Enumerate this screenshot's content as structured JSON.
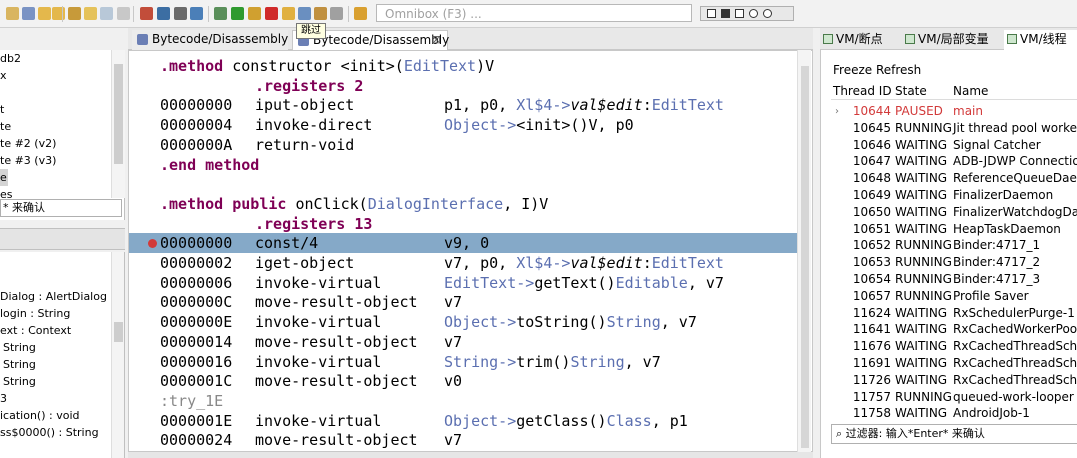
{
  "toolbar": {
    "omnibox_placeholder": "Omnibox (F3) ...",
    "tooltip": "跳过"
  },
  "left_panel": {
    "top_items": [
      "db2",
      "x",
      "",
      "t",
      "te",
      "te #2 (v2)",
      "te #3 (v3)",
      "e",
      "es"
    ],
    "filter_text": "* 来确认",
    "bottom_items": [
      "Dialog : AlertDialog",
      "login : String",
      "ext : Context",
      "String",
      "String",
      "String",
      "3",
      "ication() : void",
      "ss$0000() : String"
    ]
  },
  "editor": {
    "tabs": [
      {
        "label": "Bytecode/Disassembly"
      },
      {
        "label": "Bytecode/Disassembly",
        "close": "⊠"
      }
    ],
    "lines": [
      {
        "type": "directive",
        "kw": ".method",
        "text": " constructor <init>(",
        "ty": "EditText",
        "end": ")V"
      },
      {
        "type": "registers",
        "text": ".registers 2"
      },
      {
        "type": "instr",
        "addr": "00000000",
        "op": "iput-object",
        "args_pre": "p1, p0, ",
        "args_ty": "Xl$4->",
        "args_it": "val$edit",
        "args_post": ":",
        "args_ty2": "EditText"
      },
      {
        "type": "instr",
        "addr": "00000004",
        "op": "invoke-direct",
        "args_ty": "Object->",
        "args_pre": "<init>()V, p0"
      },
      {
        "type": "instr",
        "addr": "0000000A",
        "op": "return-void"
      },
      {
        "type": "end",
        "kw": ".end method"
      },
      {
        "type": "blank"
      },
      {
        "type": "directive2",
        "kw": ".method public",
        "text": " onClick(",
        "ty": "DialogInterface",
        "end": ", I)V"
      },
      {
        "type": "registers",
        "text": ".registers 13"
      },
      {
        "type": "instr",
        "addr": "00000000",
        "op": "const/4",
        "args_pre": "v9, 0",
        "highlight": true,
        "breakpoint": true
      },
      {
        "type": "instr",
        "addr": "00000002",
        "op": "iget-object",
        "args_pre": "v7, p0, ",
        "args_ty": "Xl$4->",
        "args_it": "val$edit",
        "args_post": ":",
        "args_ty2": "EditText"
      },
      {
        "type": "instr",
        "addr": "00000006",
        "op": "invoke-virtual",
        "args_ty": "EditText->",
        "args_pre": "getText()",
        "args_ty2": "Editable",
        "args_post": ", v7"
      },
      {
        "type": "instr",
        "addr": "0000000C",
        "op": "move-result-object",
        "args_pre": "v7"
      },
      {
        "type": "instr",
        "addr": "0000000E",
        "op": "invoke-virtual",
        "args_ty": "Object->",
        "args_pre": "toString()",
        "args_ty2": "String",
        "args_post": ", v7"
      },
      {
        "type": "instr",
        "addr": "00000014",
        "op": "move-result-object",
        "args_pre": "v7"
      },
      {
        "type": "instr",
        "addr": "00000016",
        "op": "invoke-virtual",
        "args_ty": "String->",
        "args_pre": "trim()",
        "args_ty2": "String",
        "args_post": ", v7"
      },
      {
        "type": "instr",
        "addr": "0000001C",
        "op": "move-result-object",
        "args_pre": "v0"
      },
      {
        "type": "label",
        "text": ":try_1E"
      },
      {
        "type": "instr",
        "addr": "0000001E",
        "op": "invoke-virtual",
        "args_ty": "Object->",
        "args_pre": "getClass()",
        "args_ty2": "Class",
        "args_post": ", p1"
      },
      {
        "type": "instr",
        "addr": "00000024",
        "op": "move-result-object",
        "args_pre": "v7"
      }
    ]
  },
  "right_panel": {
    "tabs": [
      "VM/断点",
      "VM/局部变量",
      "VM/线程"
    ],
    "freeze_label": "Freeze Refresh",
    "columns": [
      "Thread ID",
      "State",
      "Name"
    ],
    "threads": [
      {
        "id": "10644",
        "state": "PAUSED",
        "name": "main",
        "paused": true
      },
      {
        "id": "10645",
        "state": "RUNNING",
        "name": "Jit thread pool worker t"
      },
      {
        "id": "10646",
        "state": "WAITING",
        "name": "Signal Catcher"
      },
      {
        "id": "10647",
        "state": "WAITING",
        "name": "ADB-JDWP Connection C"
      },
      {
        "id": "10648",
        "state": "WAITING",
        "name": "ReferenceQueueDaemo"
      },
      {
        "id": "10649",
        "state": "WAITING",
        "name": "FinalizerDaemon"
      },
      {
        "id": "10650",
        "state": "WAITING",
        "name": "FinalizerWatchdogDaem"
      },
      {
        "id": "10651",
        "state": "WAITING",
        "name": "HeapTaskDaemon"
      },
      {
        "id": "10652",
        "state": "RUNNING",
        "name": "Binder:4717_1"
      },
      {
        "id": "10653",
        "state": "RUNNING",
        "name": "Binder:4717_2"
      },
      {
        "id": "10654",
        "state": "RUNNING",
        "name": "Binder:4717_3"
      },
      {
        "id": "10657",
        "state": "RUNNING",
        "name": "Profile Saver"
      },
      {
        "id": "11624",
        "state": "WAITING",
        "name": "RxSchedulerPurge-1"
      },
      {
        "id": "11641",
        "state": "WAITING",
        "name": "RxCachedWorkerPoolEv"
      },
      {
        "id": "11676",
        "state": "WAITING",
        "name": "RxCachedThreadSchedu"
      },
      {
        "id": "11691",
        "state": "WAITING",
        "name": "RxCachedThreadSchedu"
      },
      {
        "id": "11726",
        "state": "WAITING",
        "name": "RxCachedThreadSchedu"
      },
      {
        "id": "11757",
        "state": "RUNNING",
        "name": "queued-work-looper"
      },
      {
        "id": "11758",
        "state": "WAITING",
        "name": "AndroidJob-1"
      }
    ],
    "filter_text": "过滤器: 输入*Enter* 来确认"
  },
  "colors": {
    "keyword": "#7f0055",
    "type": "#5b6fb0",
    "highlight": "#85a9c8",
    "paused": "#d23a3a"
  }
}
